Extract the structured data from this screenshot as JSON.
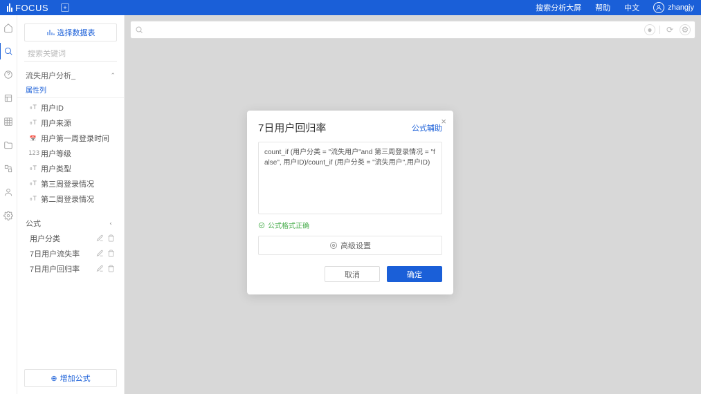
{
  "header": {
    "logo": "FOCUS",
    "right": {
      "search_screen": "搜索分析大屏",
      "help": "帮助",
      "lang": "中文",
      "user": "zhangjy"
    }
  },
  "sidebar": {
    "select_source": "选择数据表",
    "search_placeholder": "搜索关键词",
    "group_title": "流失用户分析_",
    "sub_label": "属性列",
    "columns": [
      {
        "icon": "T",
        "label": "用户ID"
      },
      {
        "icon": "T",
        "label": "用户来源"
      },
      {
        "icon": "date",
        "label": "用户第一周登录时间"
      },
      {
        "icon": "123",
        "label": "用户等级"
      },
      {
        "icon": "T",
        "label": "用户类型"
      },
      {
        "icon": "T",
        "label": "第三周登录情况"
      },
      {
        "icon": "T",
        "label": "第二周登录情况"
      }
    ],
    "formula_group": "公式",
    "formulas": [
      "用户分类",
      "7日用户流失率",
      "7日用户回归率"
    ],
    "add_formula": "增加公式"
  },
  "modal": {
    "title": "7日用户回归率",
    "help": "公式辅助",
    "formula": "count_if (用户分类 = \"流失用户\"and 第三周登录情况 = \"false\", 用户ID)/count_if (用户分类 = \"流失用户\",用户ID)",
    "status": "公式格式正确",
    "advanced": "高级设置",
    "cancel": "取消",
    "confirm": "确定"
  }
}
